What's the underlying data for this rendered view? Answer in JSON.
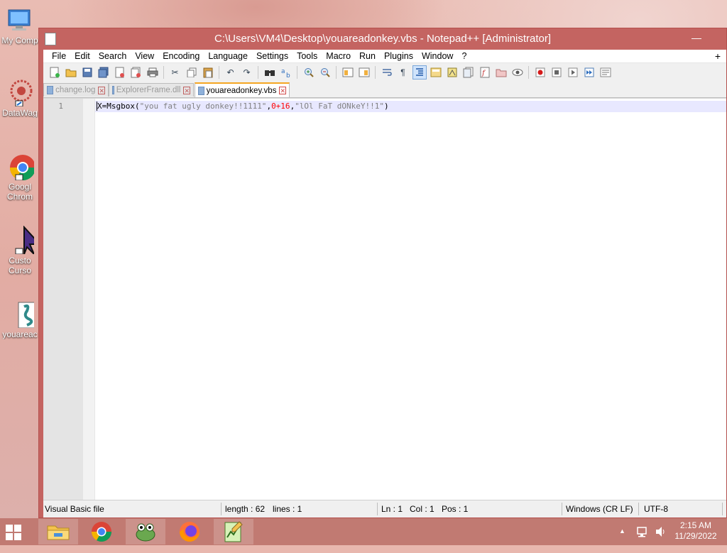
{
  "window": {
    "title": "C:\\Users\\VM4\\Desktop\\youareadonkey.vbs - Notepad++ [Administrator]",
    "minimize": "—",
    "maximize": "▢",
    "close": "✕"
  },
  "desktop_icons": [
    {
      "label": "My Comp",
      "label2": "",
      "icon": "computer-icon"
    },
    {
      "label": "DataWag",
      "label2": "",
      "icon": "datawag-icon"
    },
    {
      "label": "Googl",
      "label2": "Chrom",
      "icon": "chrome-icon"
    },
    {
      "label": "Custo",
      "label2": "Curso",
      "icon": "cursor-icon"
    },
    {
      "label": "youareac",
      "label2": "",
      "icon": "vbs-file-icon"
    }
  ],
  "menu": [
    "File",
    "Edit",
    "Search",
    "View",
    "Encoding",
    "Language",
    "Settings",
    "Tools",
    "Macro",
    "Run",
    "Plugins",
    "Window",
    "?"
  ],
  "menu_plus": "+",
  "tabs": [
    {
      "label": "change.log",
      "active": false
    },
    {
      "label": "ExplorerFrame.dll",
      "active": false
    },
    {
      "label": "youareadonkey.vbs",
      "active": true
    }
  ],
  "editor": {
    "line_number": "1",
    "code_tokens": {
      "var": "X",
      "eq": "=",
      "fn": "Msgbox",
      "open": "(",
      "str1": "\"you fat ugly donkey!!1111\"",
      "comma1": ",",
      "num": "0+16",
      "comma2": ",",
      "str2": "\"lOl FaT dONkeY!!1\"",
      "close": ")"
    }
  },
  "status": {
    "file_type": "Visual Basic file",
    "length": "length : 62",
    "lines": "lines : 1",
    "ln": "Ln : 1",
    "col": "Col : 1",
    "pos": "Pos : 1",
    "eol": "Windows (CR LF)",
    "encoding": "UTF-8"
  },
  "taskbar": {
    "apps": [
      "file-explorer-icon",
      "chrome-icon",
      "frog-app-icon",
      "firefox-icon",
      "notepadpp-icon"
    ],
    "time": "2:15 AM",
    "date": "11/29/2022",
    "tray_up": "▲"
  },
  "colors": {
    "titlebar": "#c46461",
    "taskbar": "#c17a72",
    "active_tab_accent": "#f5a623",
    "string": "#808080",
    "number": "#ff0000",
    "current_line": "#e8e8ff"
  }
}
